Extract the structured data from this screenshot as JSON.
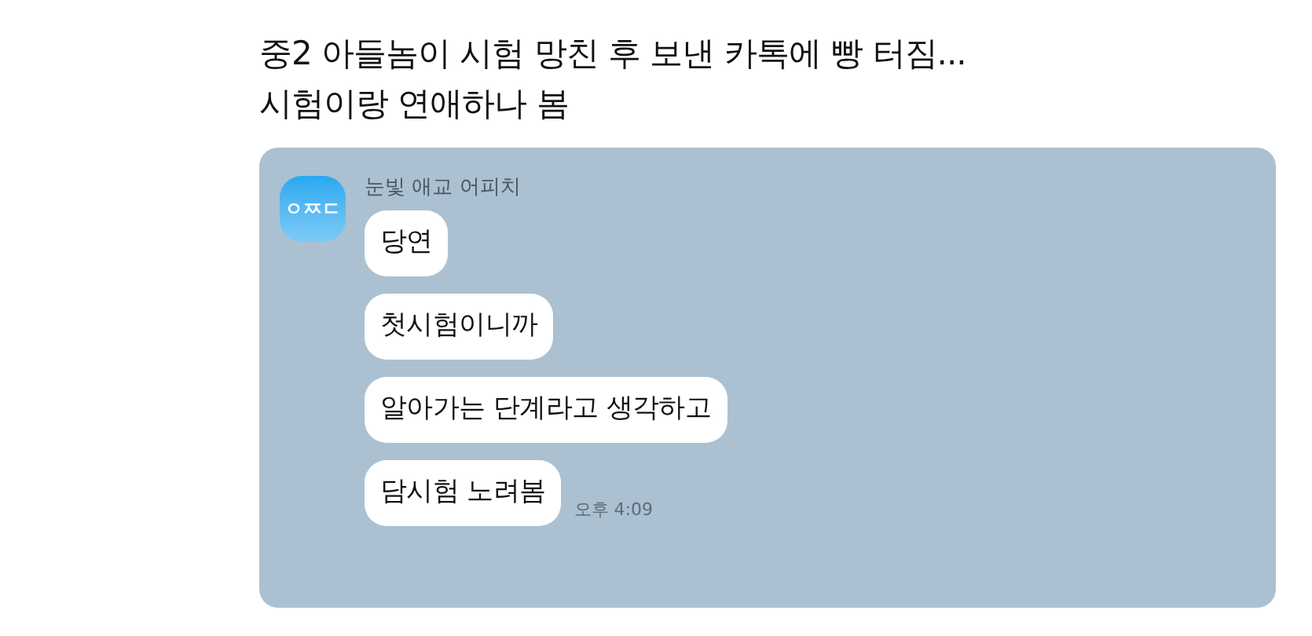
{
  "headline": [
    "중2 아들놈이 시험 망친 후 보낸 카톡에 빵 터짐...",
    "시험이랑 연애하나 봄"
  ],
  "chat": {
    "avatar_label": "ㅇㅉㄷ",
    "sender": "눈빛 애교 어피치",
    "messages": [
      {
        "text": "당연"
      },
      {
        "text": "첫시험이니까"
      },
      {
        "text": "알아가는 단계라고 생각하고"
      },
      {
        "text": "담시험 노려봄",
        "time": "오후 4:09"
      }
    ]
  }
}
